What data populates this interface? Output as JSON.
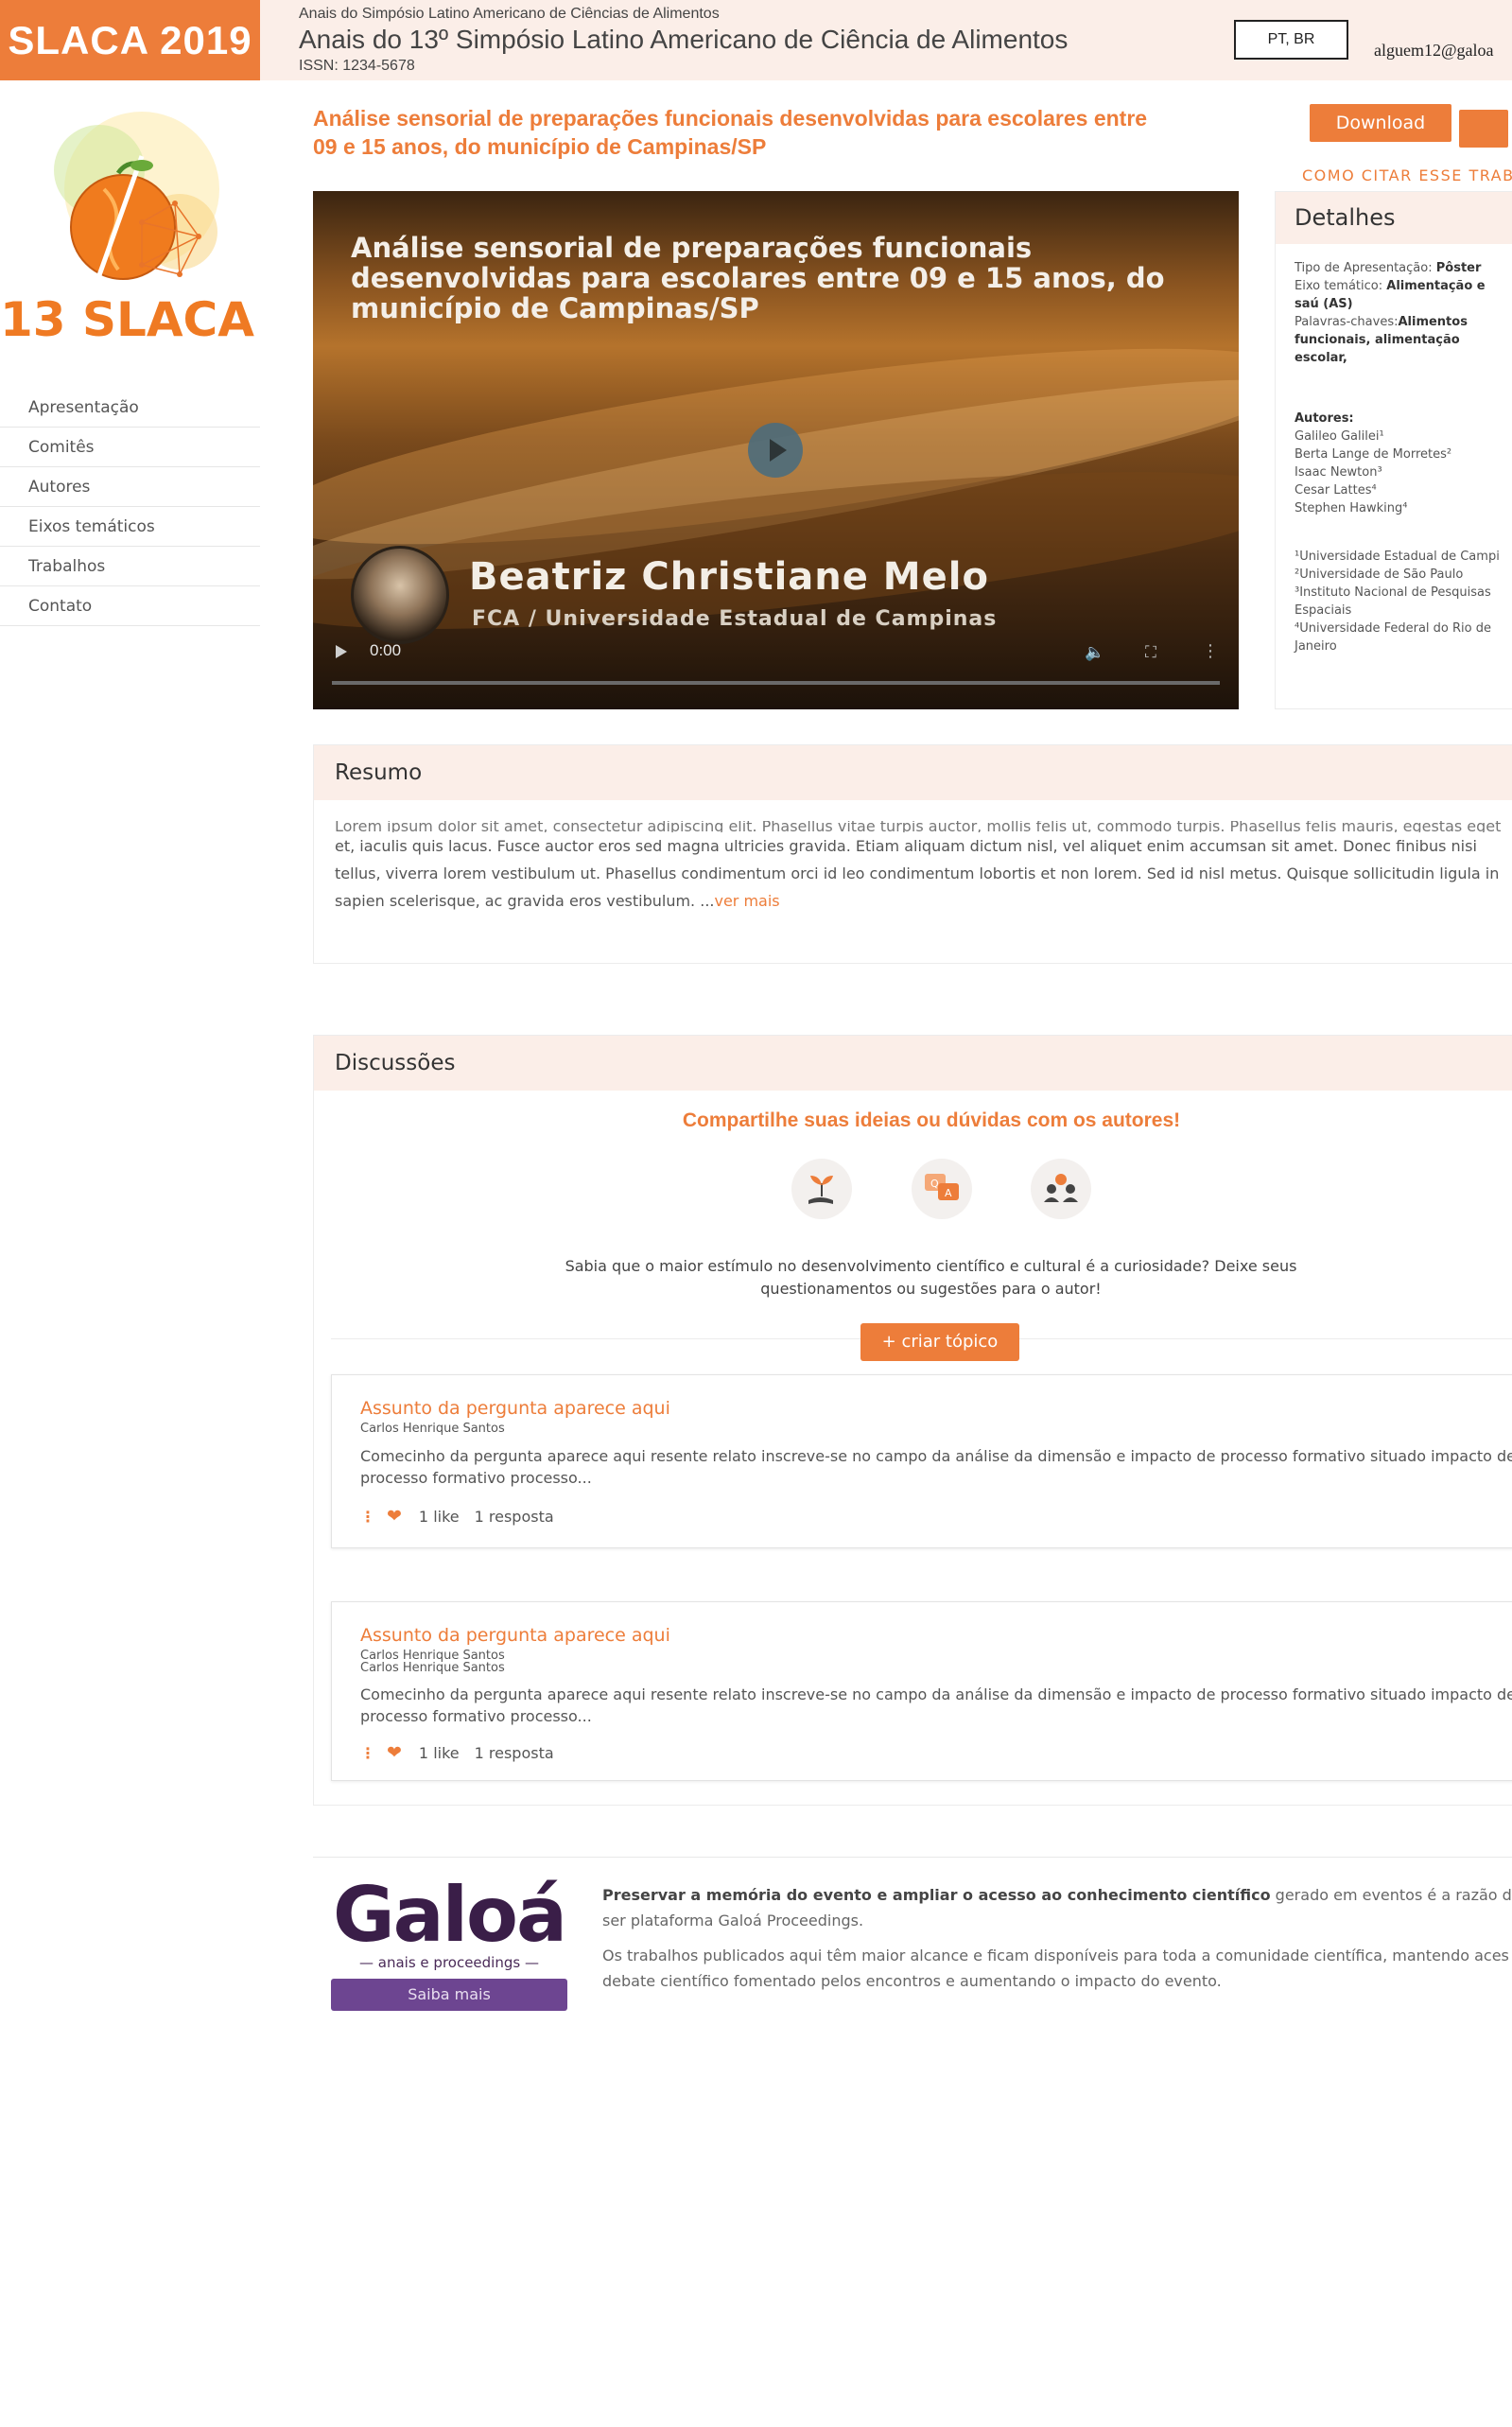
{
  "header": {
    "brand": "SLACA 2019",
    "supertitle": "Anais do Simpósio Latino Americano de Ciências de Alimentos",
    "title": "Anais do 13º Simpósio Latino Americano de Ciência de Alimentos",
    "issn": "ISSN: 1234-5678",
    "language": "PT, BR",
    "user_email": "alguem12@galoa"
  },
  "sidebar": {
    "logo_text": "13 SLACA",
    "items": [
      {
        "label": "Apresentação"
      },
      {
        "label": "Comitês"
      },
      {
        "label": "Autores"
      },
      {
        "label": "Eixos temáticos"
      },
      {
        "label": "Trabalhos"
      },
      {
        "label": "Contato"
      }
    ]
  },
  "paper": {
    "title": "Análise sensorial de preparações funcionais desenvolvidas para escolares entre 09 e 15 anos, do município de Campinas/SP",
    "download_label": "Download",
    "cite_label": "COMO CITAR ESSE TRAB"
  },
  "video": {
    "title": "Análise sensorial de preparações funcionais desenvolvidas para escolares entre 09 e 15 anos, do município de Campinas/SP",
    "speaker": "Beatriz Christiane Melo",
    "affiliation": "FCA / Universidade Estadual de Campinas",
    "time": "0:00"
  },
  "details": {
    "heading": "Detalhes",
    "type_label": "Tipo de Apresentação:",
    "type_value": "Pôster",
    "axis_label": "Eixo temático:",
    "axis_value": "Alimentação e saú (AS)",
    "keywords_label": "Palavras-chaves:",
    "keywords_value": "Alimentos funcionais, alimentação escolar,",
    "authors_label": "Autores:",
    "authors": [
      "Galileo Galilei¹",
      "Berta Lange de Morretes²",
      "Isaac Newton³",
      "Cesar Lattes⁴",
      "Stephen Hawking⁴"
    ],
    "affiliations": [
      "¹Universidade Estadual de Campi",
      "²Universidade de São Paulo",
      "³Instituto Nacional de Pesquisas Espaciais",
      "⁴Universidade Federal do Rio de Janeiro"
    ]
  },
  "resumo": {
    "heading": "Resumo",
    "line_faded": "Lorem ipsum dolor sit amet, consectetur adipiscing elit. Phasellus vitae turpis auctor, mollis felis ut, commodo turpis. Phasellus felis mauris, egestas eget aug",
    "text": "et, iaculis quis lacus. Fusce auctor eros sed magna ultricies gravida. Etiam aliquam dictum nisl, vel aliquet enim accumsan sit amet. Donec finibus nisi tellus, viverra lorem vestibulum ut. Phasellus condimentum orci id leo condimentum lobortis et non lorem. Sed id nisl metus. Quisque sollicitudin ligula in sapien scelerisque, ac gravida eros vestibulum. ...",
    "more_label": "ver mais"
  },
  "discussoes": {
    "heading": "Discussões",
    "cta": "Compartilhe suas ideias ou dúvidas com os autores!",
    "text": "Sabia que o maior estímulo no desenvolvimento científico e cultural é a curiosidade? Deixe seus questionamentos ou sugestões para o autor!",
    "new_topic_label": "+ criar tópico",
    "icons": [
      "plant-hand-icon",
      "qa-bubbles-icon",
      "people-icon"
    ],
    "topics": [
      {
        "title": "Assunto da pergunta aparece aqui",
        "authors": [
          "Carlos Henrique Santos"
        ],
        "body": "Comecinho da pergunta aparece aqui resente relato inscreve-se no campo da análise da dimensão e impacto de processo formativo situado impacto de processo formativo processo...",
        "likes": "1 like",
        "replies": "1 resposta"
      },
      {
        "title": "Assunto da pergunta aparece aqui",
        "authors": [
          "Carlos Henrique Santos",
          "Carlos Henrique Santos"
        ],
        "body": "Comecinho da pergunta aparece aqui resente relato inscreve-se no campo da análise da dimensão e impacto de processo formativo situado impacto de processo formativo processo...",
        "likes": "1 like",
        "replies": "1 resposta"
      }
    ]
  },
  "footer": {
    "logo_word": "Galoá",
    "logo_sub": "— anais e proceedings —",
    "more_label": "Saiba mais",
    "p1_bold": "Preservar a memória do evento e ampliar o acesso ao conhecimento científico",
    "p1_rest": " gerado em eventos é a razão de ser plataforma Galoá Proceedings.",
    "p2": "Os trabalhos publicados aqui têm maior alcance e ficam disponíveis para toda a comunidade científica, mantendo aces debate científico fomentado pelos encontros e aumentando o impacto do evento."
  },
  "colors": {
    "accent": "#ed7d3a",
    "header_bg": "#fbeee8",
    "galoa_purple": "#6d4591"
  }
}
